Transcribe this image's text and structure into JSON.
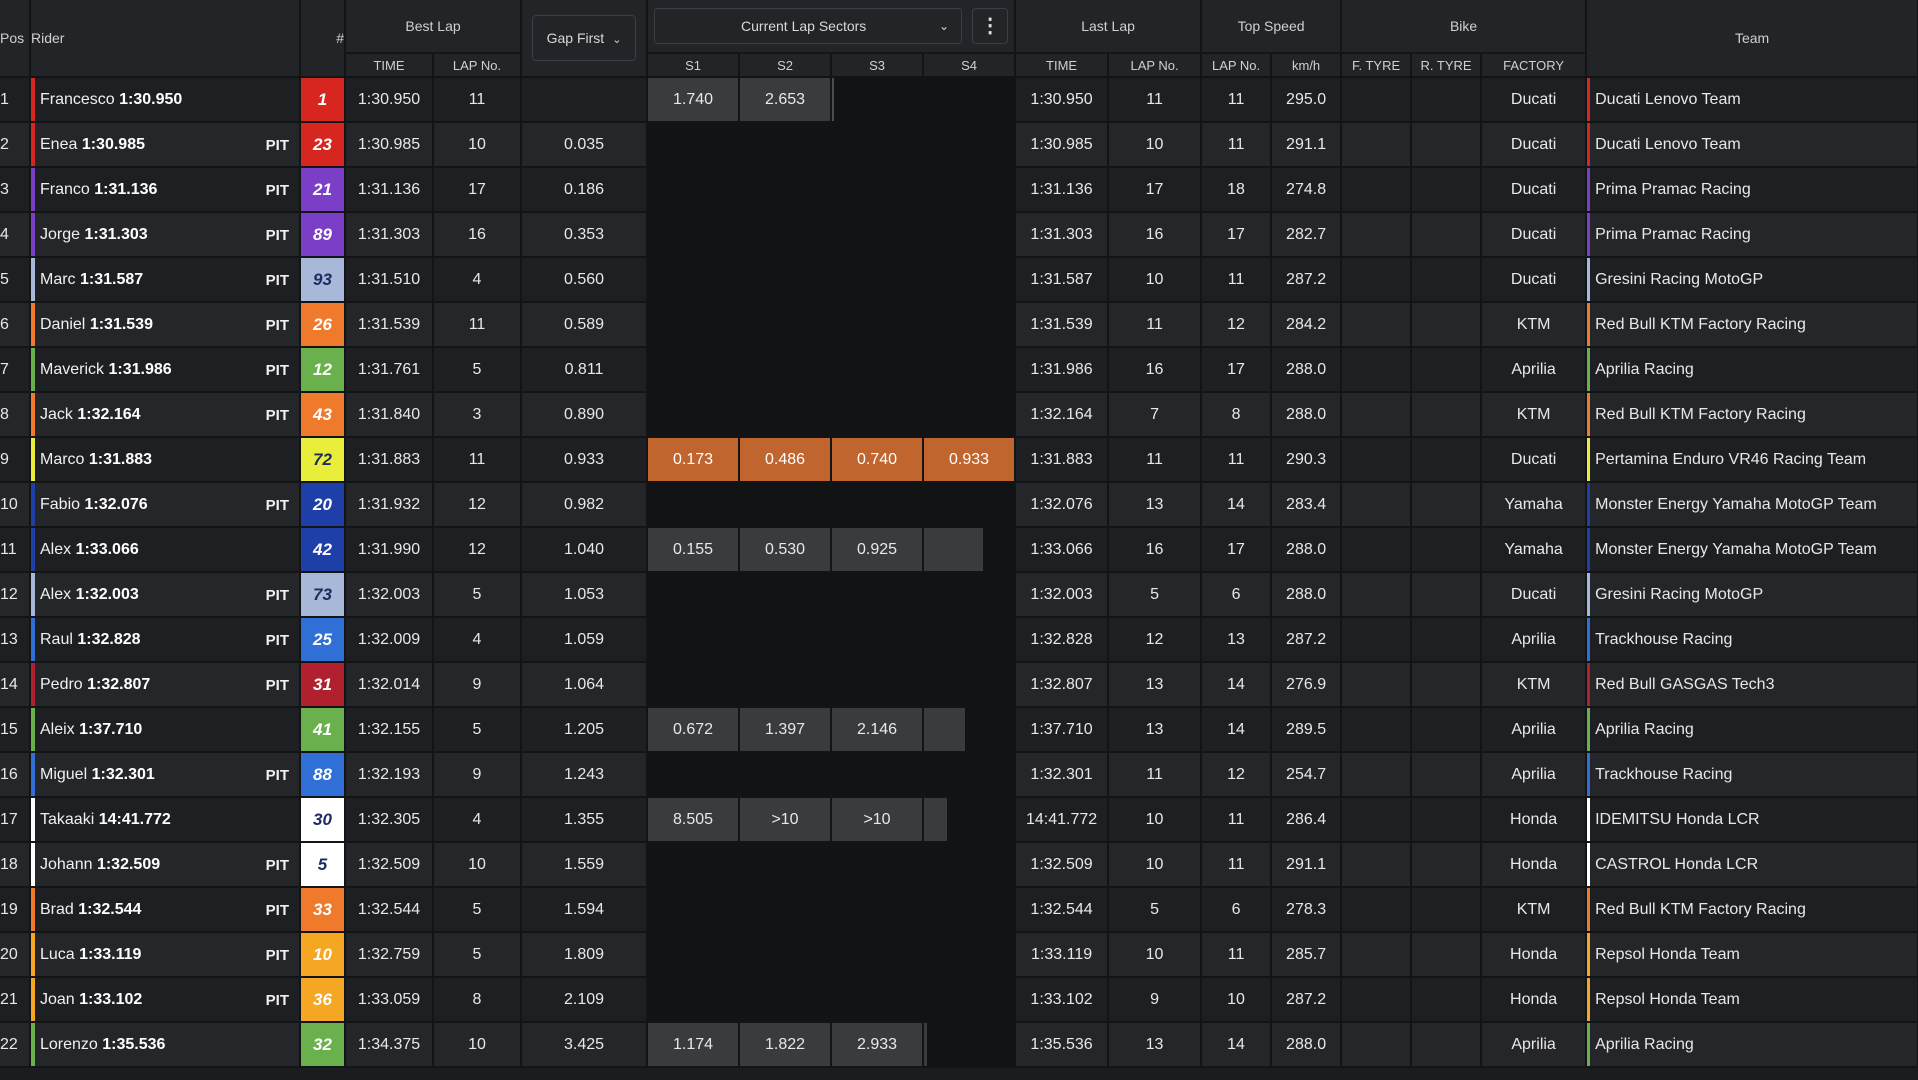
{
  "header": {
    "pos": "Pos",
    "rider": "Rider",
    "number": "#",
    "best_lap": "Best Lap",
    "best_time": "TIME",
    "best_lap_no": "LAP No.",
    "gap_first": "Gap First",
    "current_sectors": "Current Lap Sectors",
    "s1": "S1",
    "s2": "S2",
    "s3": "S3",
    "s4": "S4",
    "last_lap": "Last Lap",
    "last_time": "TIME",
    "last_lap_no": "LAP No.",
    "top_speed": "Top Speed",
    "top_lap_no": "LAP No.",
    "kmh": "km/h",
    "bike": "Bike",
    "f_tyre": "F. TYRE",
    "r_tyre": "R. TYRE",
    "factory": "FACTORY",
    "team": "Team"
  },
  "icons": {
    "gap_dropdown": "chevron-down-icon",
    "sectors_dropdown": "chevron-down-icon",
    "more_menu": "kebab-menu-icon"
  },
  "rows": [
    {
      "pos": "1",
      "first": "Francesco",
      "last": "1:30.950",
      "pit": "",
      "num": "1",
      "num_bg": "#d6261f",
      "num_dark": false,
      "best": "1:30.950",
      "best_lap": "11",
      "gap": "",
      "s1": "1.740",
      "s2": "2.653",
      "s3": "",
      "s4": "",
      "sector_state": "s1s2",
      "s3_line": true,
      "s4_fill": 0,
      "last_lap": "11",
      "top_lap": "11",
      "speed": "295.0",
      "factory": "Ducati",
      "team": "Ducati Lenovo Team",
      "team_color": "#d6261f"
    },
    {
      "pos": "2",
      "first": "Enea",
      "last": "1:30.985",
      "pit": "PIT",
      "num": "23",
      "num_bg": "#d6261f",
      "num_dark": false,
      "best": "1:30.985",
      "best_lap": "10",
      "gap": "0.035",
      "s1": "",
      "s2": "",
      "s3": "",
      "s4": "",
      "sector_state": "none",
      "s3_line": false,
      "s4_fill": 0,
      "last_lap": "10",
      "top_lap": "11",
      "speed": "291.1",
      "factory": "Ducati",
      "team": "Ducati Lenovo Team",
      "team_color": "#d6261f"
    },
    {
      "pos": "3",
      "first": "Franco",
      "last": "1:31.136",
      "pit": "PIT",
      "num": "21",
      "num_bg": "#7b3fc7",
      "num_dark": false,
      "best": "1:31.136",
      "best_lap": "17",
      "gap": "0.186",
      "s1": "",
      "s2": "",
      "s3": "",
      "s4": "",
      "sector_state": "none",
      "s3_line": false,
      "s4_fill": 0,
      "last_lap": "17",
      "top_lap": "18",
      "speed": "274.8",
      "factory": "Ducati",
      "team": "Prima Pramac Racing",
      "team_color": "#7b3fc7"
    },
    {
      "pos": "4",
      "first": "Jorge",
      "last": "1:31.303",
      "pit": "PIT",
      "num": "89",
      "num_bg": "#7b3fc7",
      "num_dark": false,
      "best": "1:31.303",
      "best_lap": "16",
      "gap": "0.353",
      "s1": "",
      "s2": "",
      "s3": "",
      "s4": "",
      "sector_state": "none",
      "s3_line": false,
      "s4_fill": 0,
      "last_lap": "16",
      "top_lap": "17",
      "speed": "282.7",
      "factory": "Ducati",
      "team": "Prima Pramac Racing",
      "team_color": "#7b3fc7"
    },
    {
      "pos": "5",
      "first": "Marc",
      "last": "1:31.587",
      "pit": "PIT",
      "num": "93",
      "num_bg": "#a8b8d8",
      "num_dark": true,
      "best": "1:31.510",
      "best_lap": "4",
      "gap": "0.560",
      "s1": "",
      "s2": "",
      "s3": "",
      "s4": "",
      "sector_state": "none",
      "s3_line": false,
      "s4_fill": 0,
      "last_lap": "10",
      "top_lap": "11",
      "speed": "287.2",
      "factory": "Ducati",
      "team": "Gresini Racing MotoGP",
      "team_color": "#a8b8d8"
    },
    {
      "pos": "6",
      "first": "Daniel",
      "last": "1:31.539",
      "pit": "PIT",
      "num": "26",
      "num_bg": "#ef7a2c",
      "num_dark": false,
      "best": "1:31.539",
      "best_lap": "11",
      "gap": "0.589",
      "s1": "",
      "s2": "",
      "s3": "",
      "s4": "",
      "sector_state": "none",
      "s3_line": false,
      "s4_fill": 0,
      "last_lap": "11",
      "top_lap": "12",
      "speed": "284.2",
      "factory": "KTM",
      "team": "Red Bull KTM Factory Racing",
      "team_color": "#ef7a2c"
    },
    {
      "pos": "7",
      "first": "Maverick",
      "last": "1:31.986",
      "pit": "PIT",
      "num": "12",
      "num_bg": "#6ab04c",
      "num_dark": false,
      "best": "1:31.761",
      "best_lap": "5",
      "gap": "0.811",
      "s1": "",
      "s2": "",
      "s3": "",
      "s4": "",
      "sector_state": "none",
      "s3_line": false,
      "s4_fill": 0,
      "last_lap": "16",
      "top_lap": "17",
      "speed": "288.0",
      "factory": "Aprilia",
      "team": "Aprilia Racing",
      "team_color": "#6ab04c"
    },
    {
      "pos": "8",
      "first": "Jack",
      "last": "1:32.164",
      "pit": "PIT",
      "num": "43",
      "num_bg": "#ef7a2c",
      "num_dark": false,
      "best": "1:31.840",
      "best_lap": "3",
      "gap": "0.890",
      "s1": "",
      "s2": "",
      "s3": "",
      "s4": "",
      "sector_state": "none",
      "s3_line": false,
      "s4_fill": 0,
      "last_lap": "7",
      "top_lap": "8",
      "speed": "288.0",
      "factory": "KTM",
      "team": "Red Bull KTM Factory Racing",
      "team_color": "#ef7a2c"
    },
    {
      "pos": "9",
      "first": "Marco",
      "last": "1:31.883",
      "pit": "",
      "num": "72",
      "num_bg": "#e8ee3a",
      "num_dark": true,
      "best": "1:31.883",
      "best_lap": "11",
      "gap": "0.933",
      "s1": "0.173",
      "s2": "0.486",
      "s3": "0.740",
      "s4": "0.933",
      "sector_state": "orange",
      "s3_line": false,
      "s4_fill": 0,
      "last_lap": "11",
      "top_lap": "11",
      "speed": "290.3",
      "factory": "Ducati",
      "team": "Pertamina Enduro VR46 Racing Team",
      "team_color": "#e8ee3a"
    },
    {
      "pos": "10",
      "first": "Fabio",
      "last": "1:32.076",
      "pit": "PIT",
      "num": "20",
      "num_bg": "#1f3fa8",
      "num_dark": false,
      "best": "1:31.932",
      "best_lap": "12",
      "gap": "0.982",
      "s1": "",
      "s2": "",
      "s3": "",
      "s4": "",
      "sector_state": "none",
      "s3_line": false,
      "s4_fill": 0,
      "last_lap": "13",
      "top_lap": "14",
      "speed": "283.4",
      "factory": "Yamaha",
      "team": "Monster Energy Yamaha MotoGP Team",
      "team_color": "#1f3fa8"
    },
    {
      "pos": "11",
      "first": "Alex",
      "last": "1:33.066",
      "pit": "",
      "num": "42",
      "num_bg": "#1f3fa8",
      "num_dark": false,
      "best": "1:31.990",
      "best_lap": "12",
      "gap": "1.040",
      "s1": "0.155",
      "s2": "0.530",
      "s3": "0.925",
      "s4": "",
      "sector_state": "s1s2s3",
      "s3_line": false,
      "s4_fill": 0.66,
      "last_lap": "16",
      "top_lap": "17",
      "speed": "288.0",
      "factory": "Yamaha",
      "team": "Monster Energy Yamaha MotoGP Team",
      "team_color": "#1f3fa8"
    },
    {
      "pos": "12",
      "first": "Alex",
      "last": "1:32.003",
      "pit": "PIT",
      "num": "73",
      "num_bg": "#a8b8d8",
      "num_dark": true,
      "best": "1:32.003",
      "best_lap": "5",
      "gap": "1.053",
      "s1": "",
      "s2": "",
      "s3": "",
      "s4": "",
      "sector_state": "none",
      "s3_line": false,
      "s4_fill": 0,
      "last_lap": "5",
      "top_lap": "6",
      "speed": "288.0",
      "factory": "Ducati",
      "team": "Gresini Racing MotoGP",
      "team_color": "#a8b8d8"
    },
    {
      "pos": "13",
      "first": "Raul",
      "last": "1:32.828",
      "pit": "PIT",
      "num": "25",
      "num_bg": "#2f6fd6",
      "num_dark": false,
      "best": "1:32.009",
      "best_lap": "4",
      "gap": "1.059",
      "s1": "",
      "s2": "",
      "s3": "",
      "s4": "",
      "sector_state": "none",
      "s3_line": false,
      "s4_fill": 0,
      "last_lap": "12",
      "top_lap": "13",
      "speed": "287.2",
      "factory": "Aprilia",
      "team": "Trackhouse Racing",
      "team_color": "#2f6fd6"
    },
    {
      "pos": "14",
      "first": "Pedro",
      "last": "1:32.807",
      "pit": "PIT",
      "num": "31",
      "num_bg": "#b0202e",
      "num_dark": false,
      "best": "1:32.014",
      "best_lap": "9",
      "gap": "1.064",
      "s1": "",
      "s2": "",
      "s3": "",
      "s4": "",
      "sector_state": "none",
      "s3_line": false,
      "s4_fill": 0,
      "last_lap": "13",
      "top_lap": "14",
      "speed": "276.9",
      "factory": "KTM",
      "team": "Red Bull GASGAS Tech3",
      "team_color": "#b0202e"
    },
    {
      "pos": "15",
      "first": "Aleix",
      "last": "1:37.710",
      "pit": "",
      "num": "41",
      "num_bg": "#6ab04c",
      "num_dark": false,
      "best": "1:32.155",
      "best_lap": "5",
      "gap": "1.205",
      "s1": "0.672",
      "s2": "1.397",
      "s3": "2.146",
      "s4": "",
      "sector_state": "s1s2s3",
      "s3_line": false,
      "s4_fill": 0.45,
      "last_lap": "13",
      "top_lap": "14",
      "speed": "289.5",
      "factory": "Aprilia",
      "team": "Aprilia Racing",
      "team_color": "#6ab04c"
    },
    {
      "pos": "16",
      "first": "Miguel",
      "last": "1:32.301",
      "pit": "PIT",
      "num": "88",
      "num_bg": "#2f6fd6",
      "num_dark": false,
      "best": "1:32.193",
      "best_lap": "9",
      "gap": "1.243",
      "s1": "",
      "s2": "",
      "s3": "",
      "s4": "",
      "sector_state": "none",
      "s3_line": false,
      "s4_fill": 0,
      "last_lap": "11",
      "top_lap": "12",
      "speed": "254.7",
      "factory": "Aprilia",
      "team": "Trackhouse Racing",
      "team_color": "#2f6fd6"
    },
    {
      "pos": "17",
      "first": "Takaaki",
      "last": "14:41.772",
      "pit": "",
      "num": "30",
      "num_bg": "#ffffff",
      "num_dark": true,
      "best": "1:32.305",
      "best_lap": "4",
      "gap": "1.355",
      "s1": "8.505",
      "s2": ">10",
      "s3": ">10",
      "s4": "",
      "sector_state": "s1s2s3",
      "s3_line": false,
      "s4_fill": 0.25,
      "last_lap": "10",
      "top_lap": "11",
      "speed": "286.4",
      "factory": "Honda",
      "team": "IDEMITSU Honda LCR",
      "team_color": "#ffffff"
    },
    {
      "pos": "18",
      "first": "Johann",
      "last": "1:32.509",
      "pit": "PIT",
      "num": "5",
      "num_bg": "#ffffff",
      "num_dark": true,
      "best": "1:32.509",
      "best_lap": "10",
      "gap": "1.559",
      "s1": "",
      "s2": "",
      "s3": "",
      "s4": "",
      "sector_state": "none",
      "s3_line": false,
      "s4_fill": 0,
      "last_lap": "10",
      "top_lap": "11",
      "speed": "291.1",
      "factory": "Honda",
      "team": "CASTROL Honda LCR",
      "team_color": "#ffffff"
    },
    {
      "pos": "19",
      "first": "Brad",
      "last": "1:32.544",
      "pit": "PIT",
      "num": "33",
      "num_bg": "#ef7a2c",
      "num_dark": false,
      "best": "1:32.544",
      "best_lap": "5",
      "gap": "1.594",
      "s1": "",
      "s2": "",
      "s3": "",
      "s4": "",
      "sector_state": "none",
      "s3_line": false,
      "s4_fill": 0,
      "last_lap": "5",
      "top_lap": "6",
      "speed": "278.3",
      "factory": "KTM",
      "team": "Red Bull KTM Factory Racing",
      "team_color": "#ef7a2c"
    },
    {
      "pos": "20",
      "first": "Luca",
      "last": "1:33.119",
      "pit": "PIT",
      "num": "10",
      "num_bg": "#f5a623",
      "num_dark": false,
      "best": "1:32.759",
      "best_lap": "5",
      "gap": "1.809",
      "s1": "",
      "s2": "",
      "s3": "",
      "s4": "",
      "sector_state": "none",
      "s3_line": false,
      "s4_fill": 0,
      "last_lap": "10",
      "top_lap": "11",
      "speed": "285.7",
      "factory": "Honda",
      "team": "Repsol Honda Team",
      "team_color": "#f5a623"
    },
    {
      "pos": "21",
      "first": "Joan",
      "last": "1:33.102",
      "pit": "PIT",
      "num": "36",
      "num_bg": "#f5a623",
      "num_dark": false,
      "best": "1:33.059",
      "best_lap": "8",
      "gap": "2.109",
      "s1": "",
      "s2": "",
      "s3": "",
      "s4": "",
      "sector_state": "none",
      "s3_line": false,
      "s4_fill": 0,
      "last_lap": "9",
      "top_lap": "10",
      "speed": "287.2",
      "factory": "Honda",
      "team": "Repsol Honda Team",
      "team_color": "#f5a623"
    },
    {
      "pos": "22",
      "first": "Lorenzo",
      "last": "1:35.536",
      "pit": "",
      "num": "32",
      "num_bg": "#6ab04c",
      "num_dark": false,
      "best": "1:34.375",
      "best_lap": "10",
      "gap": "3.425",
      "s1": "1.174",
      "s2": "1.822",
      "s3": "2.933",
      "s4": "",
      "sector_state": "s1s2s3",
      "s3_line": false,
      "s4_fill": 0.03,
      "last_lap": "13",
      "top_lap": "14",
      "speed": "288.0",
      "factory": "Aprilia",
      "team": "Aprilia Racing",
      "team_color": "#6ab04c"
    }
  ]
}
